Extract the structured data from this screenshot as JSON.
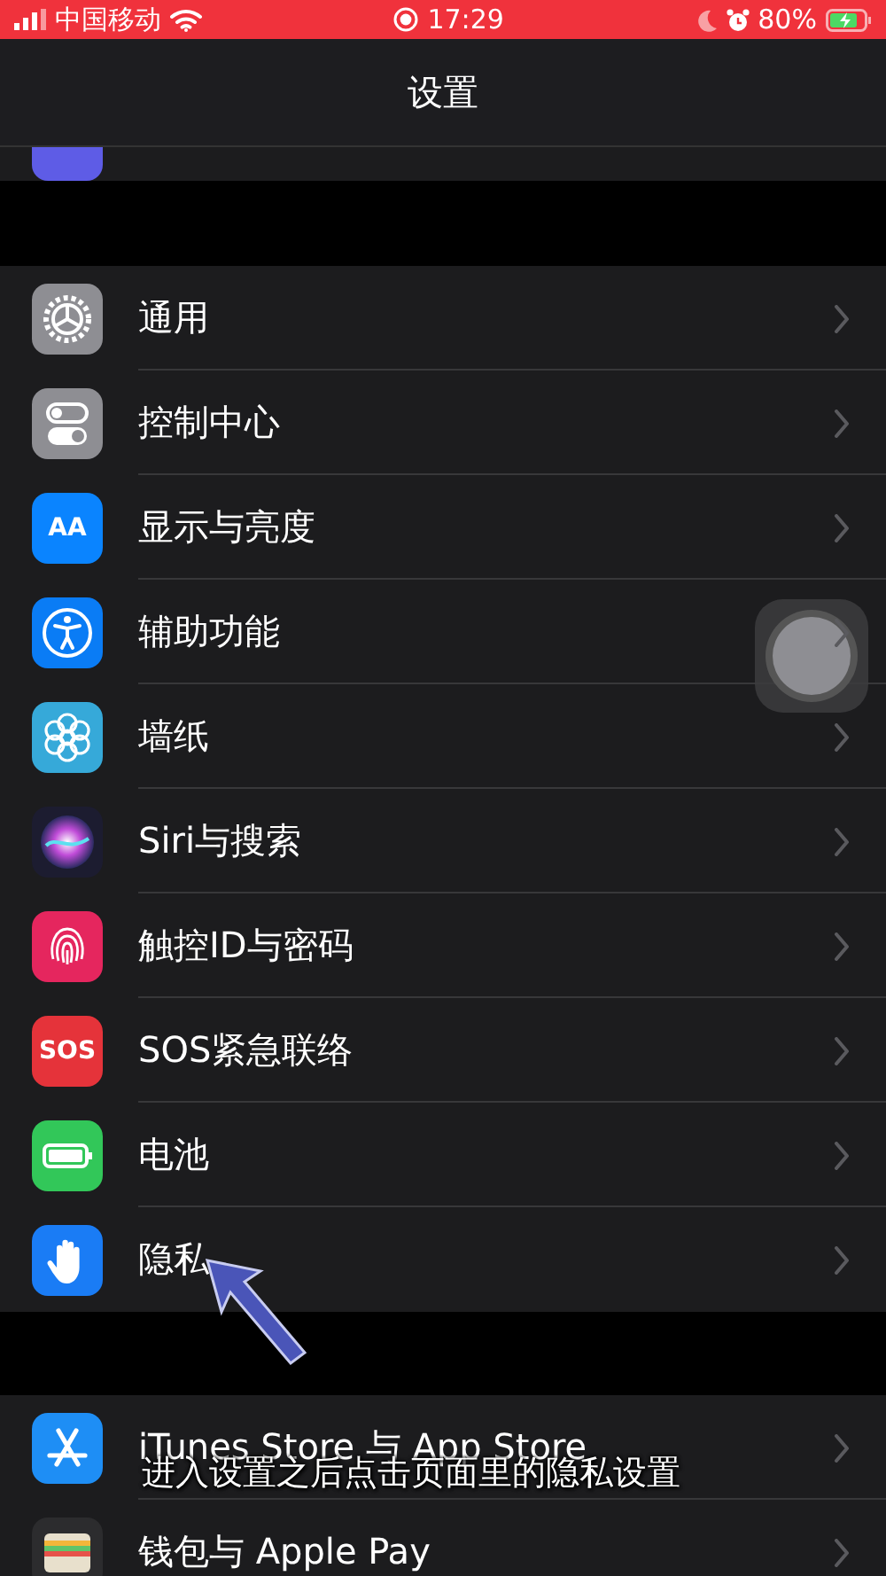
{
  "status_bar": {
    "carrier": "中国移动",
    "time": "17:29",
    "battery": "80%"
  },
  "nav": {
    "title": "设置"
  },
  "groups": [
    {
      "rows": [
        {
          "label": "通用"
        },
        {
          "label": "控制中心"
        },
        {
          "label": "显示与亮度",
          "icon_text": "AA"
        },
        {
          "label": "辅助功能"
        },
        {
          "label": "墙纸"
        },
        {
          "label": "Siri与搜索"
        },
        {
          "label": "触控ID与密码"
        },
        {
          "label": "SOS紧急联络",
          "icon_text": "SOS"
        },
        {
          "label": "电池"
        },
        {
          "label": "隐私"
        }
      ]
    },
    {
      "rows": [
        {
          "label": "iTunes Store 与 App Store"
        },
        {
          "label": "钱包与 Apple Pay"
        }
      ]
    }
  ],
  "caption": "进入设置之后点击页面里的隐私设置"
}
